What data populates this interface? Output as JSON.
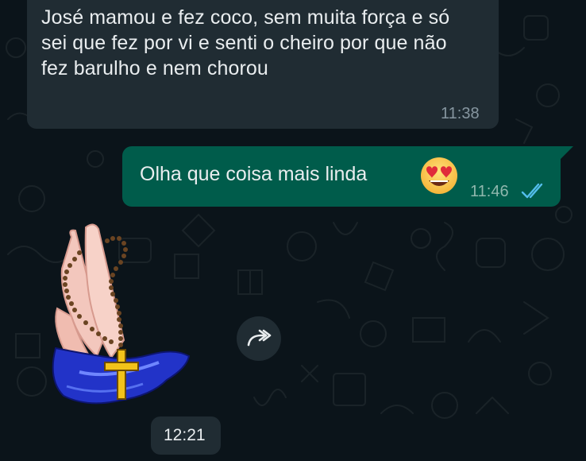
{
  "chat": {
    "messages": [
      {
        "direction": "incoming",
        "text": "José mamou e fez coco, sem muita força e só sei que fez por vi e senti o cheiro por que não fez barulho e nem chorou",
        "time": "11:38"
      },
      {
        "direction": "outgoing",
        "text": "Olha que coisa mais linda",
        "emoji": "smiling-face-with-heart-eyes",
        "time": "11:46",
        "status": "read-double-check"
      },
      {
        "direction": "incoming",
        "type": "sticker",
        "sticker": "praying-hands-with-rosary",
        "time": "12:21"
      }
    ],
    "forward_icon": "forward-icon"
  },
  "colors": {
    "background": "#0b141a",
    "incoming_bubble": "#202c33",
    "outgoing_bubble": "#005c4b",
    "text": "#e9edef",
    "timestamp": "#8696a0",
    "read_ticks": "#53bdeb"
  }
}
